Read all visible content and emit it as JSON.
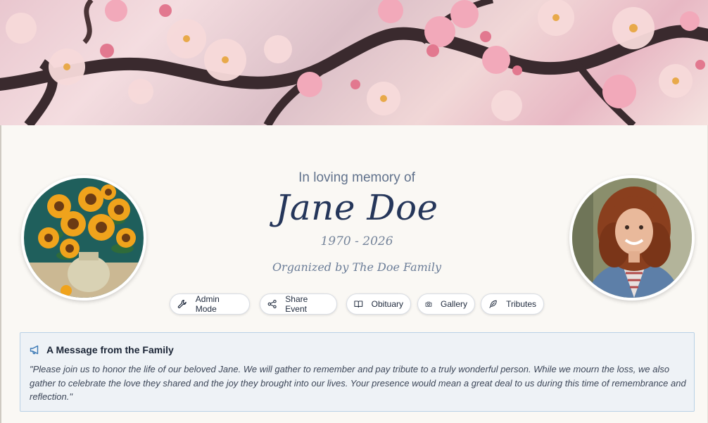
{
  "header": {
    "pre_title": "In loving memory of",
    "name": "Jane Doe",
    "dates": "1970 - 2026",
    "organizer": "Organized by The Doe Family"
  },
  "images": {
    "banner": "cherry-blossom-painting",
    "left_portrait": "sunflower-vase-painting",
    "right_portrait": "smiling-woman-photo"
  },
  "actions": [
    {
      "label": "Admin Mode",
      "icon": "wrench-icon"
    },
    {
      "label": "Share Event",
      "icon": "share-icon"
    },
    {
      "label": "Obituary",
      "icon": "book-icon"
    },
    {
      "label": "Gallery",
      "icon": "camera-icon"
    },
    {
      "label": "Tributes",
      "icon": "feather-icon"
    }
  ],
  "message": {
    "title": "A Message from the Family",
    "icon": "megaphone-icon",
    "body": "\"Please join us to honor the life of our beloved Jane. We will gather to remember and pay tribute to a truly wonderful person. While we mourn the loss, we also gather to celebrate the love they shared and the joy they brought into our lives. Your presence would mean a great deal to us during this time of remembrance and reflection.\""
  },
  "colors": {
    "page_bg": "#faf8f4",
    "name_text": "#25365a",
    "accent_blue": "#3a78b5",
    "message_bg": "#eef2f6",
    "message_border": "#b9d1e6"
  }
}
